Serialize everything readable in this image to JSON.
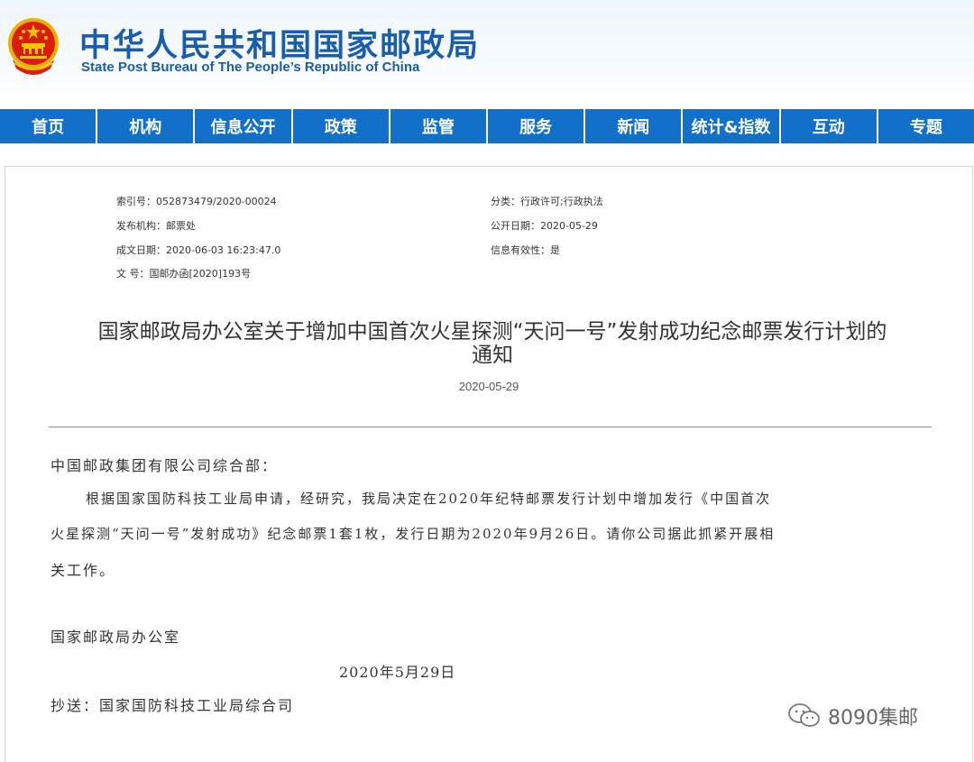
{
  "header": {
    "title": "中华人民共和国国家邮政局",
    "subtitle": "State Post Bureau of The People’s Republic of China"
  },
  "nav": {
    "items": [
      "首页",
      "机构",
      "信息公开",
      "政策",
      "监管",
      "服务",
      "新闻",
      "统计&指数",
      "互动",
      "专题"
    ]
  },
  "meta": {
    "index_no": "索引号：052873479/2020-00024",
    "category": "分类：行政许可;行政执法",
    "issuer": "发布机构：邮票处",
    "publish_date": "公开日期：2020-05-29",
    "created_date": "成文日期：2020-06-03 16:23:47.0",
    "validity": "信息有效性：是",
    "doc_no": "文  号：国邮办函[2020]193号"
  },
  "document": {
    "title_line1": "国家邮政局办公室关于增加中国首次火星探测“天问一号”发射成功纪念邮票发行计划的",
    "title_line2": "通知",
    "date": "2020-05-29",
    "salutation": "中国邮政集团有限公司综合部：",
    "body_line1": "根据国家国防科技工业局申请，经研究，我局决定在2020年纪特邮票发行计划中增加发行《中国首次",
    "body_line2": "火星探测“天问一号”发射成功》纪念邮票1套1枚，发行日期为2020年9月26日。请你公司据此抓紧开展相",
    "body_line3": "关工作。",
    "signature": "国家邮政局办公室",
    "signature_date": "2020年5月29日",
    "cc": "抄送：国家国防科技工业局综合司"
  },
  "watermark": {
    "text": "8090集邮",
    "icon": "wechat-icon"
  },
  "colors": {
    "brand": "#1a5da8",
    "nav_bg": "#1270c8",
    "emblem_red": "#d81e06",
    "emblem_gold": "#f5c400"
  }
}
